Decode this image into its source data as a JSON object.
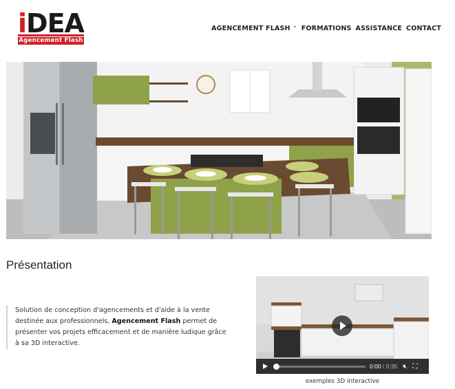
{
  "header": {
    "logo_main_prefix": "i",
    "logo_main_rest": "DEA",
    "logo_sub": "Agencement Flash",
    "nav": [
      {
        "label": "AGENCEMENT FLASH",
        "dropdown": true
      },
      {
        "label": "FORMATIONS",
        "dropdown": false
      },
      {
        "label": "ASSISTANCE",
        "dropdown": false
      },
      {
        "label": "CONTACT",
        "dropdown": false
      }
    ],
    "dropdown_caret": "ˇ"
  },
  "presentation": {
    "title": "Présentation",
    "text_before": "Solution de conception d'agencements et d'aide à la vente destinée aux professionnels, ",
    "text_bold": "Agencement Flash",
    "text_after": " permet de présenter vos projets efficacement et de manière ludique grâce à sa 3D interactive."
  },
  "video": {
    "current_time": "0:00",
    "separator": "/",
    "duration": "0:35",
    "progress_fraction": 0.0,
    "caption": "exemples 3D interactive"
  },
  "colors": {
    "brand_red": "#d21f26",
    "kitchen_green": "#8fa24a",
    "wood": "#6a4a30"
  }
}
